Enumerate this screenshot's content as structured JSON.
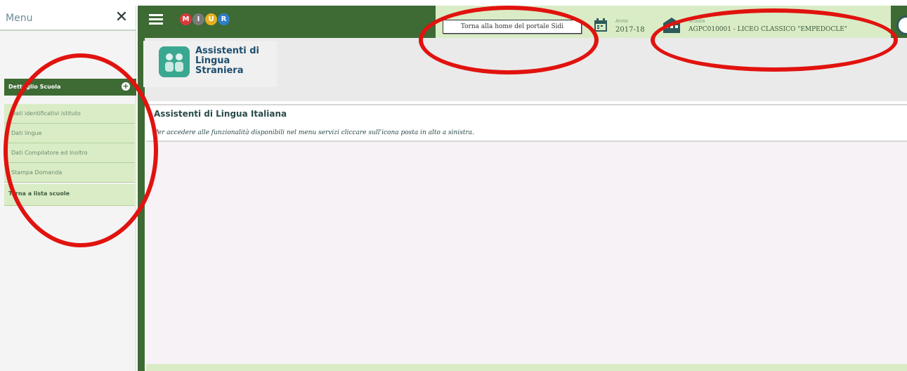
{
  "sidebar": {
    "title": "Menu",
    "section_label": "Dettaglio Scuola",
    "items": [
      {
        "label": "Dati identificativi istituto"
      },
      {
        "label": "Dati lingue"
      },
      {
        "label": "Dati Compilatore ed Inoltro"
      },
      {
        "label": "Stampa Domanda"
      }
    ],
    "back_label": "Torna a lista scuole"
  },
  "topbar": {
    "logo_letters": [
      "M",
      "I",
      "U",
      "R"
    ],
    "home_tooltip": "Torna alla home del portale Sidi",
    "anno_label": "Anno",
    "anno_value": "2017-18",
    "scuola_label": "Scuola",
    "scuola_value": "AGPC010001 - LICEO CLASSICO \"EMPEDOCLE\""
  },
  "app": {
    "name": "Assistenti di Lingua Straniera"
  },
  "content": {
    "title": "Assistenti di Lingua Italiana",
    "info": "Per accedere alle funzionalità disponibili nel menu servizi cliccare sull'icona posta in alto a sinistra."
  },
  "colors": {
    "primary_green": "#3e6a34",
    "light_green": "#d9ecc6",
    "annotation_red": "#e1130f"
  }
}
